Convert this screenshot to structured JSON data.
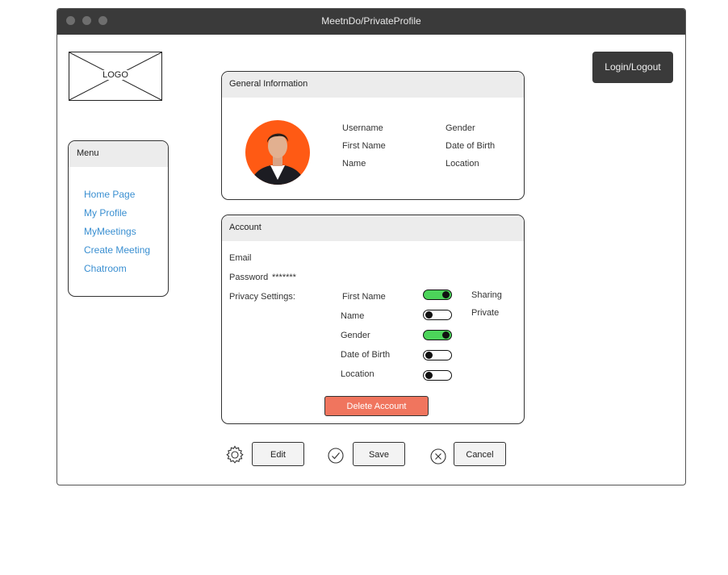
{
  "window": {
    "title": "MeetnDo/PrivateProfile"
  },
  "logo": {
    "text": "LOGO"
  },
  "header": {
    "login_label": "Login/Logout"
  },
  "menu": {
    "title": "Menu",
    "items": [
      "Home Page",
      "My Profile",
      "MyMeetings",
      "Create Meeting",
      "Chatroom"
    ]
  },
  "general": {
    "title": "General Information",
    "avatar_icon": "profile-photo",
    "fields_left": [
      "Username",
      "First Name",
      "Name"
    ],
    "fields_right": [
      "Gender",
      "Date of Birth",
      "Location"
    ]
  },
  "account": {
    "title": "Account",
    "email_label": "Email",
    "password_label": "Password",
    "password_value": "*******",
    "privacy_label": "Privacy Settings:",
    "privacy": [
      {
        "label": "First Name",
        "state": "on"
      },
      {
        "label": "Name",
        "state": "off"
      },
      {
        "label": "Gender",
        "state": "on"
      },
      {
        "label": "Date of Birth",
        "state": "off"
      },
      {
        "label": "Location",
        "state": "off"
      }
    ],
    "legend_on": "Sharing",
    "legend_off": "Private",
    "delete_label": "Delete Account"
  },
  "actions": {
    "edit_label": "Edit",
    "save_label": "Save",
    "cancel_label": "Cancel"
  },
  "colors": {
    "titlebar": "#3a3a3a",
    "toggle_on": "#4cd45a",
    "delete": "#f0755e",
    "link": "#3a8fd1",
    "avatar_bg": "#ff5a14"
  }
}
